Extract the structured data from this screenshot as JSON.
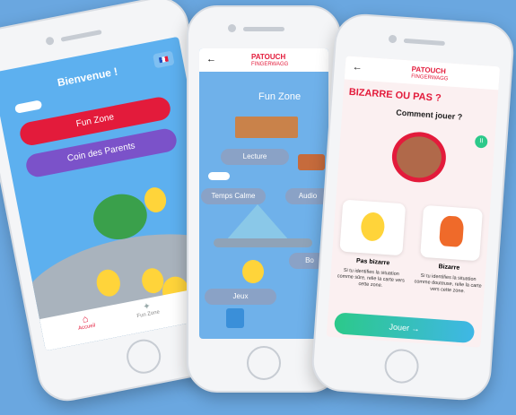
{
  "phone1": {
    "title": "Bienvenue !",
    "buttons": [
      "Fun Zone",
      "Coin des Parents"
    ],
    "tabs": [
      "Accueil",
      "Fun Zone"
    ]
  },
  "phone2": {
    "brand": "PATOUCH",
    "brand_sub": "FINGERWAGG",
    "title": "Fun Zone",
    "labels": [
      "Lecture",
      "Temps Calme",
      "Audio",
      "Bo",
      "Jeux"
    ],
    "back": "←"
  },
  "phone3": {
    "brand": "PATOUCH",
    "brand_sub": "FINGERWAGG",
    "back": "←",
    "heading": "BIZARRE OU PAS ?",
    "subheading": "Comment jouer ?",
    "pause": "II",
    "card_left_title": "Pas bizarre",
    "card_left_text": "Si tu identifies la situation comme sûre, relie la carte vers cette zone.",
    "card_right_title": "Bizarre",
    "card_right_text": "Si tu identifies la situation comme douteuse, relie la carte vers cette zone.",
    "play_button": "Jouer →"
  },
  "colors": {
    "red": "#e31b3b",
    "purple": "#7b52c9",
    "green": "#2cc98a",
    "blue": "#3fb7e6"
  }
}
